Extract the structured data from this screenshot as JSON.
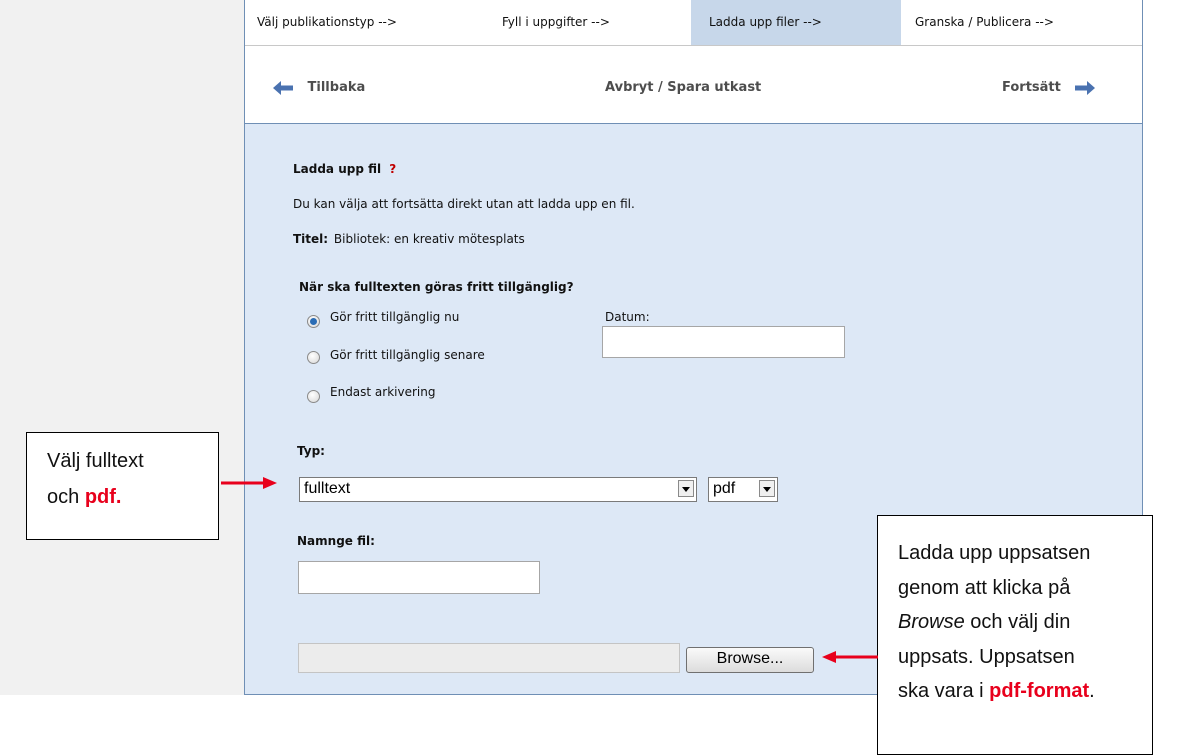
{
  "tabs": [
    {
      "label": "Välj publikationstyp -->"
    },
    {
      "label": "Fyll i uppgifter -->"
    },
    {
      "label": "Ladda upp filer -->",
      "active": true
    },
    {
      "label": "Granska / Publicera -->"
    }
  ],
  "nav": {
    "back_label": "Tillbaka",
    "cancel_label": "Avbryt / Spara utkast",
    "next_label": "Fortsätt"
  },
  "form": {
    "heading": "Ladda upp fil",
    "help_mark": "?",
    "info": "Du kan välja att fortsätta direkt utan att ladda upp en fil.",
    "title_label": "Titel:",
    "title_value": "Bibliotek: en kreativ mötesplats",
    "access_question": "När ska fulltexten göras fritt tillgänglig?",
    "access_options": [
      {
        "label": "Gör fritt tillgänglig nu",
        "checked": true
      },
      {
        "label": "Gör fritt tillgänglig senare",
        "checked": false
      },
      {
        "label": "Endast arkivering",
        "checked": false
      }
    ],
    "date_label": "Datum:",
    "date_value": "",
    "type_label": "Typ:",
    "type_selected": "fulltext",
    "format_selected": "pdf",
    "filename_label": "Namnge fil:",
    "filename_value": "",
    "file_path_value": "",
    "browse_label": "Browse..."
  },
  "callouts": {
    "left_line1": "Välj fulltext",
    "left_line2_prefix": "och ",
    "left_line2_emph": "pdf.",
    "right_line1": "Ladda upp uppsatsen",
    "right_line2": "genom att klicka på",
    "right_line3_emph": "Browse",
    "right_line3_rest": " och välj din",
    "right_line4": "uppsats. Uppsatsen",
    "right_line5_prefix": "ska vara i ",
    "right_line5_emph": "pdf-format",
    "right_line5_suffix": "."
  },
  "colors": {
    "active_tab": "#c7d7ea",
    "content_bg": "#dde8f6",
    "arrow_nav": "#4a72b0",
    "arrow_callout": "#e8001c",
    "help_mark": "#c00000"
  },
  "icons": {
    "back": "arrow-left-icon",
    "next": "arrow-right-icon"
  }
}
